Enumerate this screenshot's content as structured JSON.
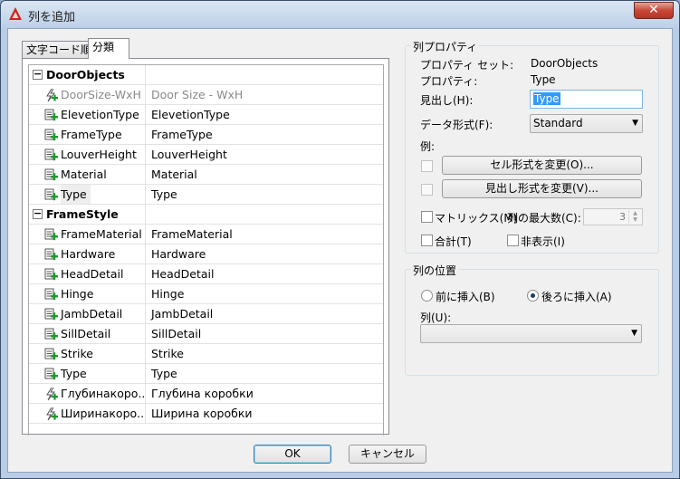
{
  "window": {
    "title": "列を追加",
    "close_glyph": "✕"
  },
  "tabs": [
    {
      "label": "文字コード順"
    },
    {
      "label": "分類"
    }
  ],
  "tree": {
    "toggle_glyph": "−",
    "groups": [
      {
        "name": "DoorObjects",
        "rows": [
          {
            "name": "DoorSize-WxH",
            "value": "Door Size - WxH",
            "icon": "formula-icon",
            "muted": true
          },
          {
            "name": "ElevetionType",
            "value": "ElevetionType",
            "icon": "property-icon"
          },
          {
            "name": "FrameType",
            "value": "FrameType",
            "icon": "property-icon"
          },
          {
            "name": "LouverHeight",
            "value": "LouverHeight",
            "icon": "property-icon"
          },
          {
            "name": "Material",
            "value": "Material",
            "icon": "property-icon"
          },
          {
            "name": "Type",
            "value": "Type",
            "icon": "property-icon",
            "selected": true
          }
        ]
      },
      {
        "name": "FrameStyle",
        "rows": [
          {
            "name": "FrameMaterial",
            "value": "FrameMaterial",
            "icon": "property-icon"
          },
          {
            "name": "Hardware",
            "value": "Hardware",
            "icon": "property-icon"
          },
          {
            "name": "HeadDetail",
            "value": "HeadDetail",
            "icon": "property-icon"
          },
          {
            "name": "Hinge",
            "value": "Hinge",
            "icon": "property-icon"
          },
          {
            "name": "JambDetail",
            "value": "JambDetail",
            "icon": "property-icon"
          },
          {
            "name": "SillDetail",
            "value": "SillDetail",
            "icon": "property-icon"
          },
          {
            "name": "Strike",
            "value": "Strike",
            "icon": "property-icon"
          },
          {
            "name": "Type",
            "value": "Type",
            "icon": "property-icon"
          },
          {
            "name": "Глубинакоро...",
            "value": "Глубина коробки",
            "icon": "formula-icon"
          },
          {
            "name": "Ширинакоро...",
            "value": "Ширина коробки",
            "icon": "formula-icon"
          }
        ]
      }
    ]
  },
  "column_properties": {
    "title": "列プロパティ",
    "property_set_label": "プロパティ セット:",
    "property_set_value": "DoorObjects",
    "property_label": "プロパティ:",
    "property_value": "Type",
    "heading_label": "見出し(H):",
    "heading_label_key": "H",
    "heading_value": "Type",
    "data_format_label": "データ形式(F):",
    "data_format_key": "F",
    "data_format_value": "Standard",
    "example_label": "例:",
    "change_cell_format_button": "セル形式を変更(O)...",
    "change_heading_format_button": "見出し形式を変更(V)...",
    "matrix_label": "マトリックス(M)",
    "max_columns_label": "列の最大数(C):",
    "max_columns_value": "3",
    "total_label": "合計(T)",
    "hide_label": "非表示(I)"
  },
  "column_position": {
    "title": "列の位置",
    "insert_before_label": "前に挿入(B)",
    "insert_after_label": "後ろに挿入(A)",
    "selected": "after",
    "column_label": "列(U):",
    "column_value": ""
  },
  "footer": {
    "ok_button": "OK",
    "cancel_button": "キャンセル"
  },
  "icons": {
    "dropdown": "▼",
    "spin_up": "▲",
    "spin_down": "▼"
  }
}
